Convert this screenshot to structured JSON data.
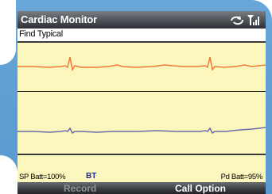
{
  "app": {
    "title": "Cardiac Monitor"
  },
  "status_icons": [
    "sync-icon",
    "signal-strength-icon"
  ],
  "toolbar": {
    "find_label": "Find Typical"
  },
  "traces": {
    "top_color": "#f07a3a",
    "bottom_color": "#6a6ea8"
  },
  "info": {
    "sp_batt": "SP Batt=100%",
    "bt": "BT",
    "pd_batt": "Pd Batt=95%"
  },
  "softkeys": {
    "left": "Record",
    "right": "Call Option"
  },
  "colors": {
    "bezel": "#5f9fd3",
    "screen_bg": "#fbf7bd",
    "titlebar": "#3c3f44",
    "bt_text": "#1a2a9a"
  }
}
